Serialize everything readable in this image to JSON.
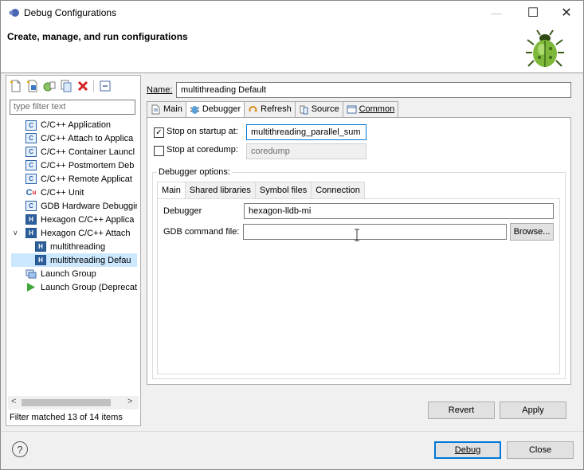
{
  "window": {
    "title": "Debug Configurations",
    "minimize_symbol": "—",
    "maximize_symbol": "☐",
    "close_symbol": "✕"
  },
  "header": {
    "title": "Create, manage, and run configurations",
    "icon": "bug-icon"
  },
  "left": {
    "toolbar_icons": [
      "new-configuration-icon",
      "new-prototype-icon",
      "export-icon",
      "duplicate-icon",
      "delete-icon",
      "collapse-all-icon"
    ],
    "filter_placeholder": "type filter text",
    "tree": [
      {
        "label": "C/C++ Application",
        "icon": "c"
      },
      {
        "label": "C/C++ Attach to Applica",
        "icon": "c"
      },
      {
        "label": "C/C++ Container Launcl",
        "icon": "c"
      },
      {
        "label": "C/C++ Postmortem Deb",
        "icon": "c"
      },
      {
        "label": "C/C++ Remote Applicat",
        "icon": "c"
      },
      {
        "label": "C/C++ Unit",
        "icon": "cu"
      },
      {
        "label": "GDB Hardware Debuggir",
        "icon": "c"
      },
      {
        "label": "Hexagon C/C++ Applica",
        "icon": "h"
      },
      {
        "label": "Hexagon C/C++ Attach",
        "icon": "h"
      },
      {
        "label": "multithreading",
        "icon": "h"
      },
      {
        "label": "multithreading Defau",
        "icon": "h"
      },
      {
        "label": "Launch Group",
        "icon": "lg"
      },
      {
        "label": "Launch Group (Deprecat",
        "icon": "run"
      }
    ],
    "filter_status": "Filter matched 13 of 14 items",
    "scroll_left": "<",
    "scroll_right": ">"
  },
  "right": {
    "name_label": "Name:",
    "name_value": "multithreading Default",
    "tabs": [
      "Main",
      "Debugger",
      "Refresh",
      "Source",
      "Common"
    ],
    "active_tab": "Debugger",
    "stop_on_startup_label": "Stop on startup at:",
    "stop_on_startup_checked": true,
    "stop_on_startup_value": "multithreading_parallel_sum",
    "stop_at_coredump_label": "Stop at coredump:",
    "stop_at_coredump_checked": false,
    "stop_at_coredump_value": "coredump",
    "debugger_options_label": "Debugger options:",
    "inner_tabs": [
      "Main",
      "Shared libraries",
      "Symbol files",
      "Connection"
    ],
    "debugger_label": "Debugger",
    "debugger_value": "hexagon-lldb-mi",
    "gdb_cmd_label": "GDB command file:",
    "gdb_cmd_value": "",
    "browse_label": "Browse...",
    "revert_label": "Revert",
    "apply_label": "Apply"
  },
  "footer": {
    "help_symbol": "?",
    "debug_label": "Debug",
    "close_label": "Close"
  }
}
